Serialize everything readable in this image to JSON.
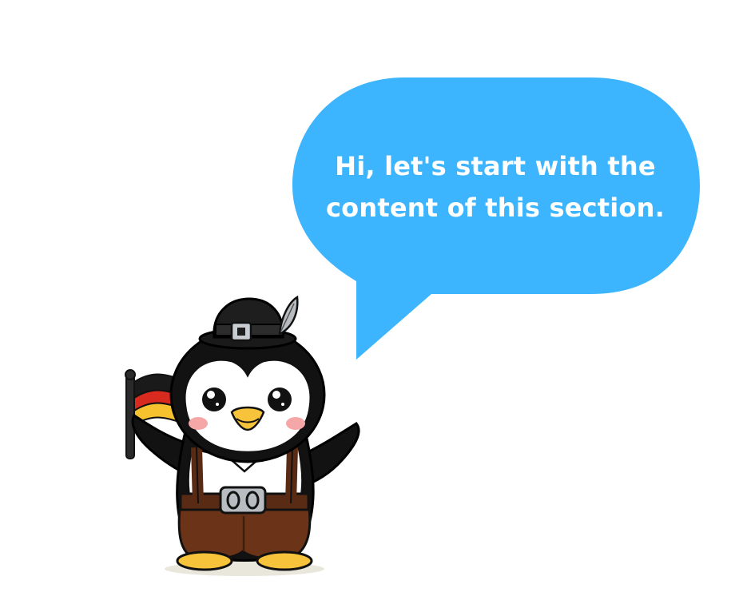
{
  "speech_bubble": {
    "line1": "Hi, let's start with the",
    "line2": "content of this section.",
    "color": "#3CB4FE",
    "text_color": "#FFFFFF"
  },
  "mascot": {
    "icon": "penguin-mascot-icon",
    "outfit": "lederhosen",
    "flag_icon": "germany-flag-icon",
    "belt_text": "00",
    "colors": {
      "body": "#121212",
      "shorts": "#6B3418",
      "beak": "#F6C33A",
      "flag_black": "#1A1A1A",
      "flag_red": "#D92A1F",
      "flag_gold": "#F6C22E"
    }
  }
}
